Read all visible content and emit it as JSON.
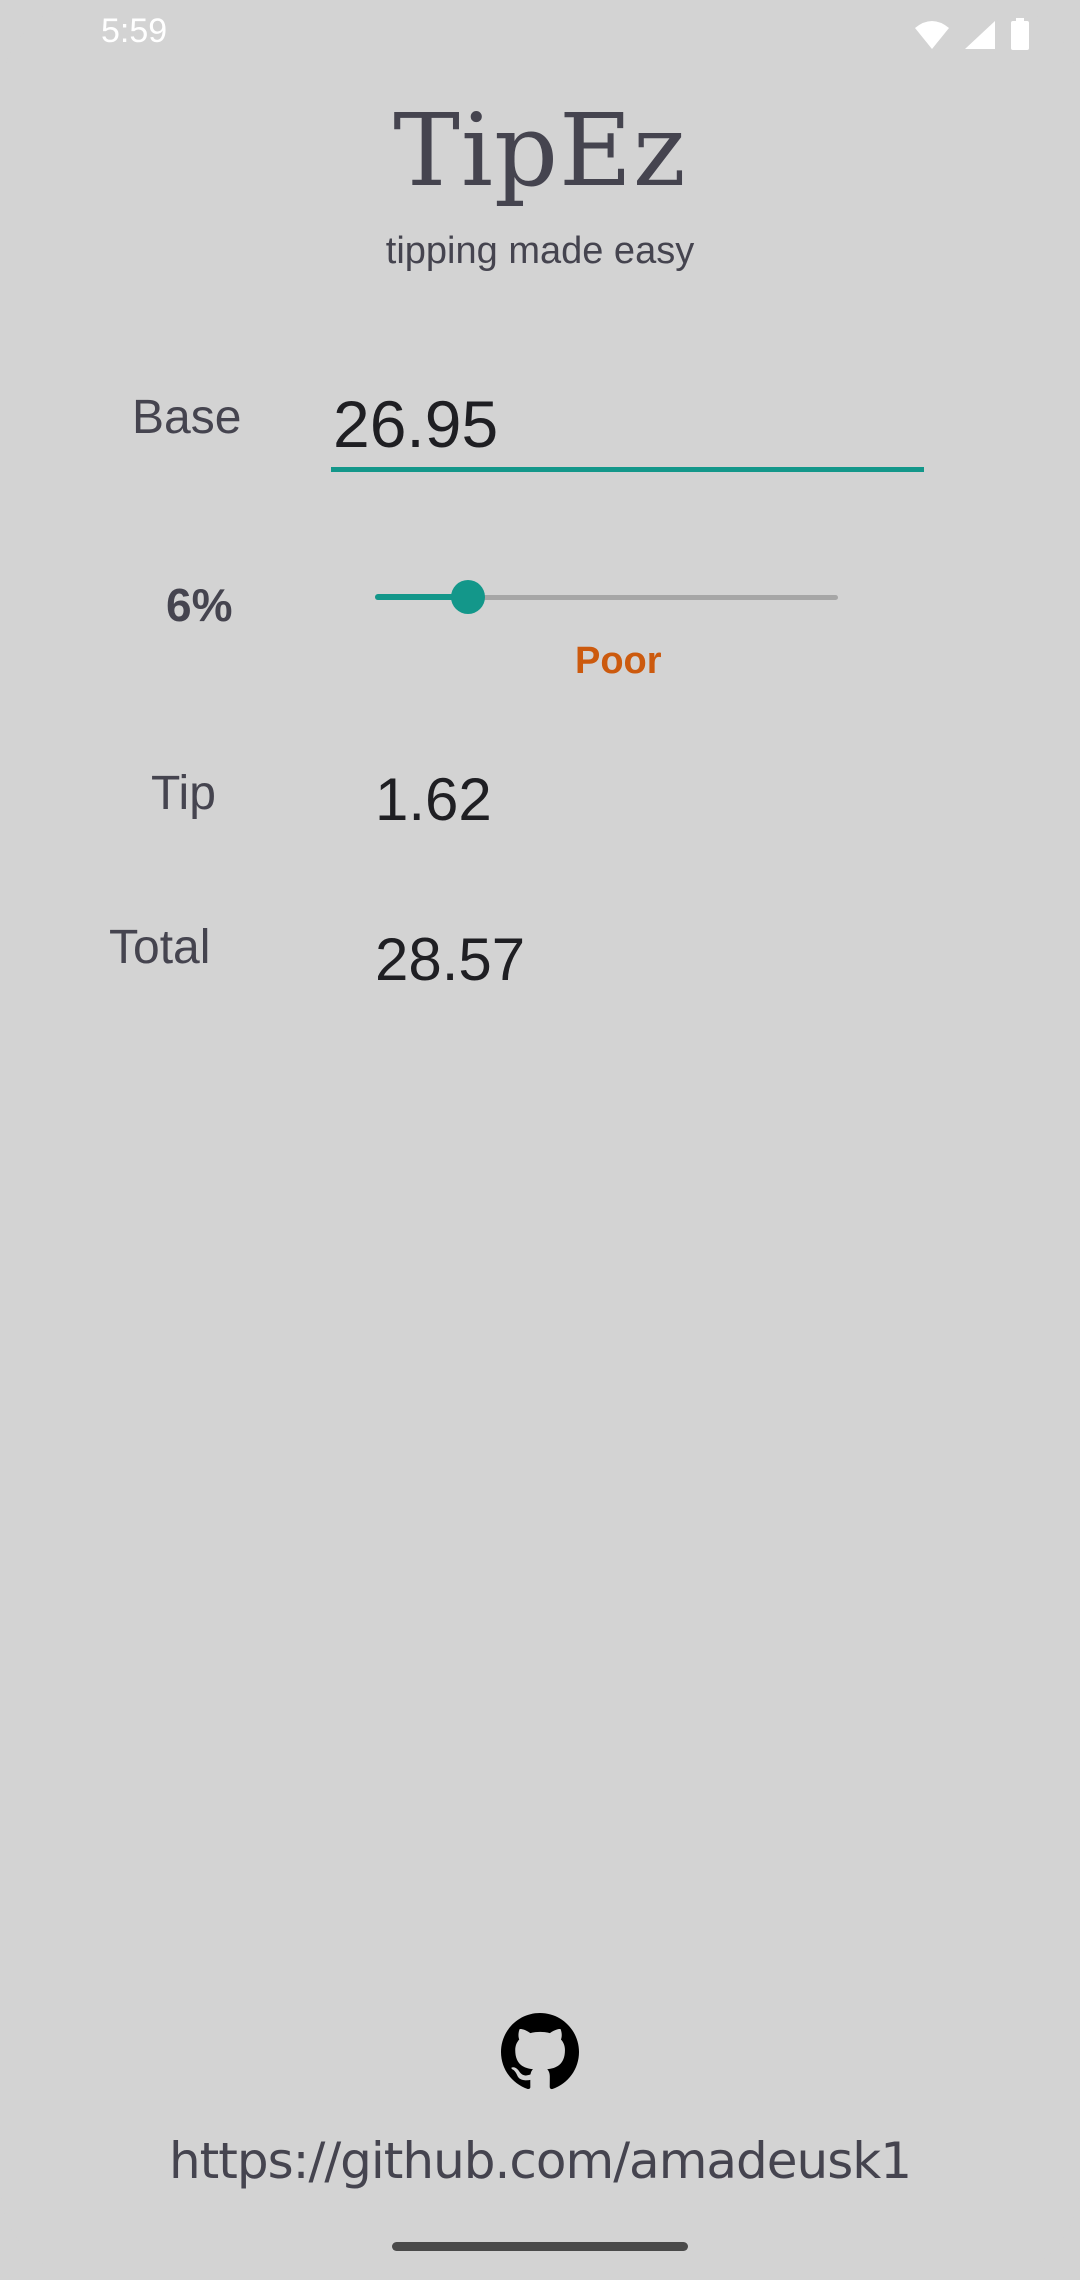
{
  "status_bar": {
    "time": "5:59"
  },
  "header": {
    "title": "TipEz",
    "subtitle": "tipping made easy"
  },
  "form": {
    "base_label": "Base",
    "base_value": "26.95",
    "percent_label": "6%",
    "tip_percent": 6,
    "slider_fraction": 0.2,
    "rating": "Poor",
    "tip_label": "Tip",
    "tip_value": "1.62",
    "total_label": "Total",
    "total_value": "28.57"
  },
  "footer": {
    "link": "https://github.com/amadeusk1"
  },
  "colors": {
    "background": "#d3d3d3",
    "accent": "#13978a",
    "rating": "#cc5a0e",
    "text": "#45444f"
  },
  "icons": {
    "wifi": "wifi-icon",
    "signal": "signal-icon",
    "battery": "battery-icon",
    "github": "github-icon"
  }
}
